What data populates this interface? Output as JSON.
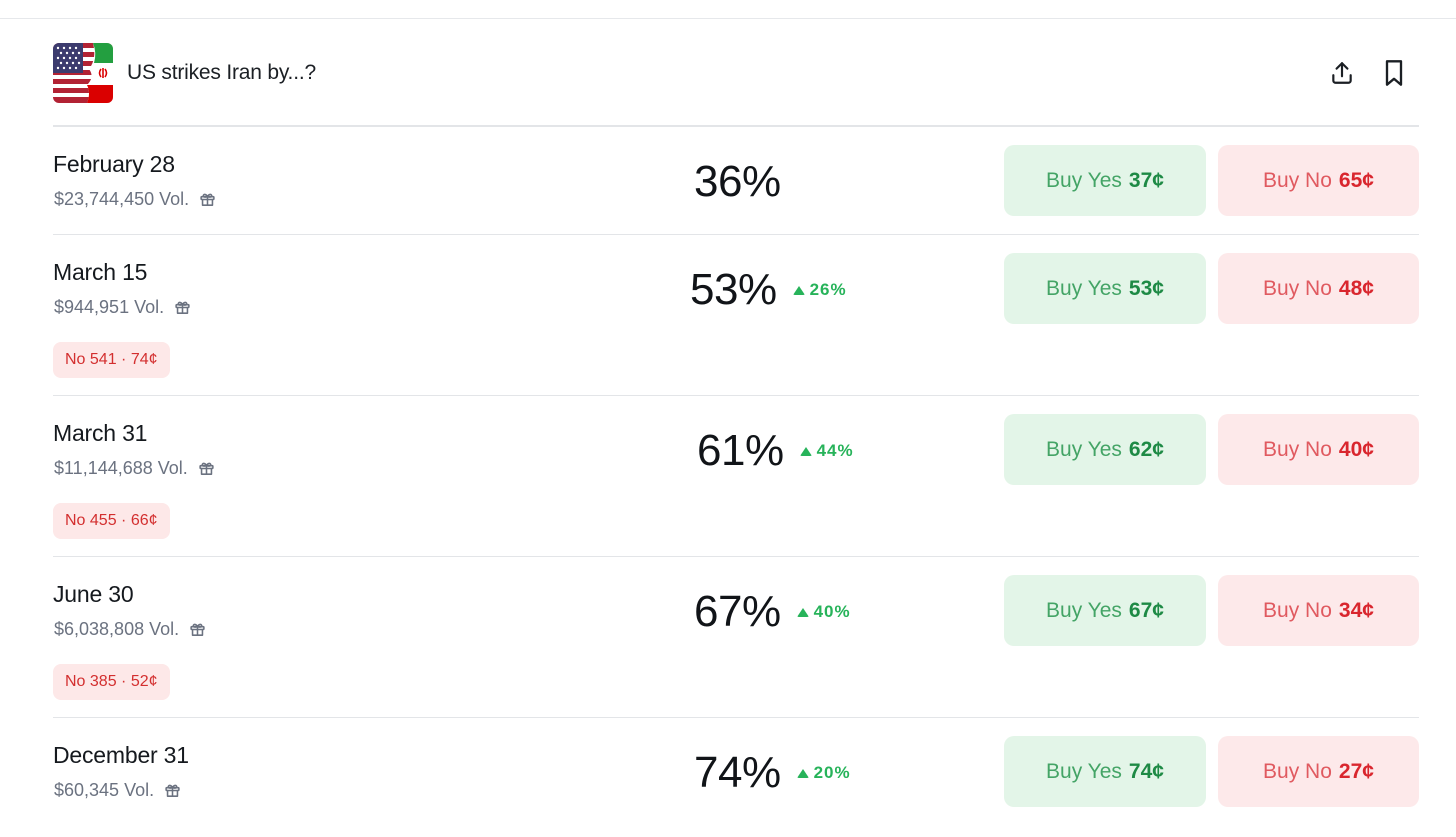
{
  "market": {
    "title": "US strikes Iran by...?",
    "flag_icon": "us-iran-flag-icon"
  },
  "header_actions": [
    {
      "name": "share-icon"
    },
    {
      "name": "bookmark-icon"
    }
  ],
  "colors": {
    "yes_bg": "#e3f5e8",
    "yes_text": "#1e8a45",
    "no_bg": "#fde9ea",
    "no_text": "#d9262e",
    "change_up": "#27b35a"
  },
  "outcomes": [
    {
      "date": "February 28",
      "volume": "$23,744,450 Vol.",
      "probability": "36%",
      "change": "",
      "yes_label": "Buy Yes",
      "yes_price": "37¢",
      "no_label": "Buy No",
      "no_price": "65¢",
      "position": ""
    },
    {
      "date": "March 15",
      "volume": "$944,951 Vol.",
      "probability": "53%",
      "change": "26%",
      "yes_label": "Buy Yes",
      "yes_price": "53¢",
      "no_label": "Buy No",
      "no_price": "48¢",
      "position": "No 541 · 74¢"
    },
    {
      "date": "March 31",
      "volume": "$11,144,688 Vol.",
      "probability": "61%",
      "change": "44%",
      "yes_label": "Buy Yes",
      "yes_price": "62¢",
      "no_label": "Buy No",
      "no_price": "40¢",
      "position": "No 455 · 66¢"
    },
    {
      "date": "June 30",
      "volume": "$6,038,808 Vol.",
      "probability": "67%",
      "change": "40%",
      "yes_label": "Buy Yes",
      "yes_price": "67¢",
      "no_label": "Buy No",
      "no_price": "34¢",
      "position": "No 385 · 52¢"
    },
    {
      "date": "December 31",
      "volume": "$60,345 Vol.",
      "probability": "74%",
      "change": "20%",
      "yes_label": "Buy Yes",
      "yes_price": "74¢",
      "no_label": "Buy No",
      "no_price": "27¢",
      "position": ""
    }
  ]
}
